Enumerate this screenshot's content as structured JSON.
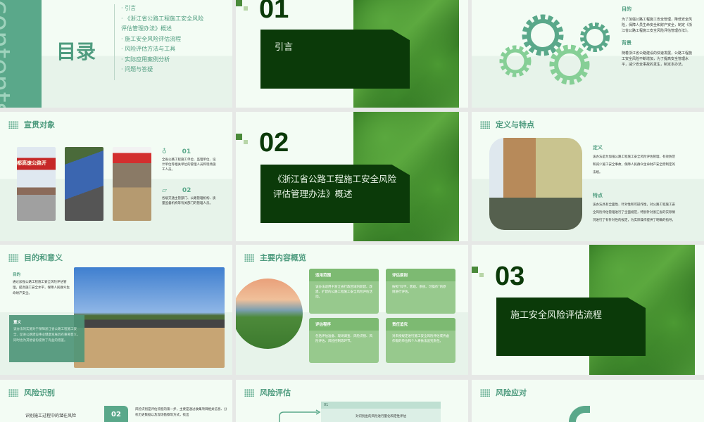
{
  "toc": {
    "bg_word": "contents",
    "title": "目录",
    "items": [
      "引言",
      "《浙江省公路工程施工安全风险评估管理办法》概述",
      "施工安全风险评估流程",
      "风险评估方法与工具",
      "实际应用案例分析",
      "问题与答疑"
    ]
  },
  "section1": {
    "number": "01",
    "title": "引言"
  },
  "purpose_background": {
    "purpose_title": "目的",
    "purpose_text": "为了加强公路工程施工安全管理，降低安全风险，保障人员生命安全和财产安全，制定《浙江省公路工程施工安全风险评估管理办法》。",
    "background_title": "背景",
    "background_text": "随着浙江省公路建设的快速发展，公路工程施工安全风险不断增加，为了提高安全管理水平，减少安全事故的发生，制定本办法。"
  },
  "audience": {
    "title": "宣贯对象",
    "photo_banner": "都高速公路开",
    "items": [
      {
        "num": "01",
        "text": "全省公路工程施工单位、监理单位、设计单位等相关单位的管理人员和现场施工人员。"
      },
      {
        "num": "02",
        "text": "各级交通主管部门、公路管理机构、质量监督机构等有关部门的管理人员。"
      }
    ]
  },
  "section2": {
    "number": "02",
    "title": "《浙江省公路工程施工安全风险评估管理办法》概述"
  },
  "definition": {
    "title": "定义与特点",
    "def_title": "定义",
    "def_text": "该办法是为加强公路工程施工安全风险评估管理，有效防范和减少施工安全事故，保障人民群众生命财产安全而制定的法规。",
    "feat_title": "特点",
    "feat_text": "该办法具有全面性、针对性和可操作性，对公路工程施工安全风险评估管理进行了全面规范，特别针对浙江省的实际情况进行了有针对性的规定，为实际操作提供了明确的指导。"
  },
  "significance": {
    "title": "目的和意义",
    "purpose_title": "目的",
    "purpose_text": "通过加强公路工程施工安全风险评估管理，提高施工安全水平，保障人民群众生命财产安全。",
    "meaning_title": "意义",
    "meaning_text": "该办法的实施对于保障浙江省公路工程施工安全、促进公路建设事业健康发展具有重要意义，同时也为其他省份提供了有益的借鉴。"
  },
  "overview": {
    "title": "主要内容概览",
    "cards": [
      {
        "title": "适用范围",
        "text": "该办法适用于浙江省行政区域内新建、改建、扩建的公路工程施工安全风险评估活动。"
      },
      {
        "title": "评估原则",
        "text": "按照“科学、客观、系统、可操作”的原则进行评估。"
      },
      {
        "title": "评估程序",
        "text": "包括评估准备、现场调查、风险识别、风险评估、风险控制等环节。"
      },
      {
        "title": "责任追究",
        "text": "对未按规定进行施工安全风险评估或弄虚作假的单位和个人将依法追究责任。"
      }
    ]
  },
  "section3": {
    "number": "03",
    "title": "施工安全风险评估流程"
  },
  "risk_id": {
    "title": "风险识别",
    "left_text": "识别施工过程中的潜在风险",
    "num": "02",
    "text": "风险识别是评估流程的第一步，主要是通过收集项目相关信息、分析历史数据以及现场勘察等方式，找出"
  },
  "risk_eval": {
    "title": "风险评估",
    "num": "01",
    "text": "对识别出的风险进行量化和定性评估"
  },
  "risk_resp": {
    "title": "风险应对"
  }
}
